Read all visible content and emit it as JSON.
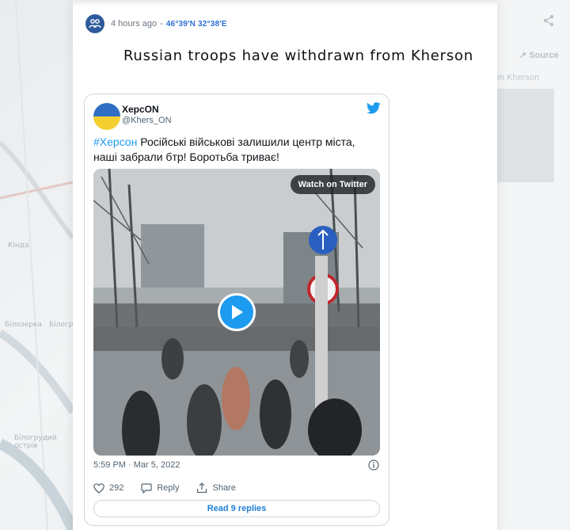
{
  "background": {
    "labels": [
      "Білозерка",
      "Білоградска",
      "Бiлогрудий острiв",
      "Кінда"
    ]
  },
  "ghost": {
    "source_label": "Source",
    "text": "m Kherson"
  },
  "post": {
    "time": "4 hours ago",
    "separator": "-",
    "coordinates": "46°39′N 32°38′E",
    "title": "Russian troops have withdrawn from Kherson"
  },
  "tweet": {
    "name": "ХерсON",
    "handle": "@Khers_ON",
    "hashtag": "#Херсон",
    "text": " Російські військові залишили центр міста, наші забрали бтр! Боротьба триває!",
    "watch_label": "Watch on Twitter",
    "date": "5:59 PM · Mar 5, 2022",
    "likes": "292",
    "reply_label": "Reply",
    "share_label": "Share",
    "read_replies_label": "Read 9 replies"
  },
  "colors": {
    "accent": "#2e6fd1",
    "twitter_blue": "#1d9bf0",
    "flag_blue": "#2f6ec4",
    "flag_yellow": "#f4cf2f"
  },
  "icons": [
    "people-icon",
    "share-icon",
    "twitter-bird-icon",
    "play-icon",
    "info-icon",
    "heart-icon",
    "reply-icon",
    "share-upload-icon"
  ]
}
